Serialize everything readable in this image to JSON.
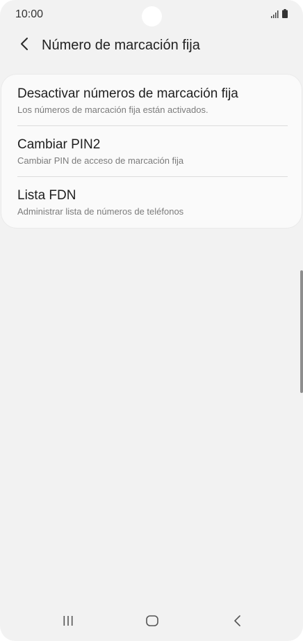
{
  "status_bar": {
    "time": "10:00",
    "icons": [
      "signal-icon",
      "battery-icon"
    ]
  },
  "header": {
    "title": "Número de marcación fija",
    "back_icon": "chevron-left-icon"
  },
  "menu": {
    "items": [
      {
        "title": "Desactivar números de marcación fija",
        "subtitle": "Los números de marcación fija están activados."
      },
      {
        "title": "Cambiar PIN2",
        "subtitle": "Cambiar PIN de acceso de marcación fija"
      },
      {
        "title": "Lista FDN",
        "subtitle": "Administrar lista de números de teléfonos"
      }
    ]
  },
  "nav_bar": {
    "buttons": [
      "recents-icon",
      "home-icon",
      "back-icon"
    ]
  },
  "colors": {
    "background": "#f2f2f2",
    "card": "#fafafa",
    "title_text": "#1f1f1f",
    "subtitle_text": "#7b7b7b"
  }
}
